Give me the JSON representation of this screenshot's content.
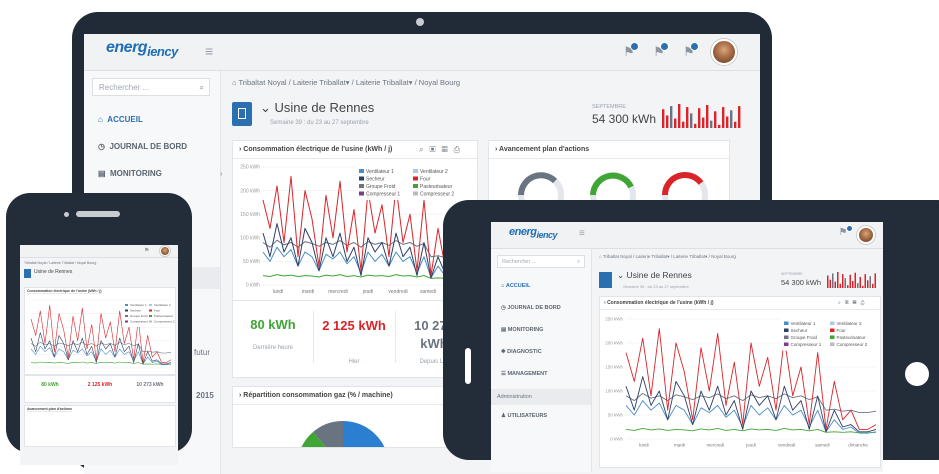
{
  "app": {
    "logo_main": "energ",
    "logo_sub": "iency"
  },
  "search": {
    "placeholder": "Rechercher ..."
  },
  "menu": [
    {
      "label": "ACCUEIL",
      "icon": "home-icon"
    },
    {
      "label": "JOURNAL DE BORD",
      "icon": "clock-icon"
    },
    {
      "label": "MONITORING",
      "icon": "chart-icon"
    },
    {
      "label": "DIAGNOSTIC",
      "icon": "gear-icon"
    },
    {
      "label": "MANAGEMENT",
      "icon": "list-icon"
    }
  ],
  "admin": {
    "section": "Administration",
    "users": "UTILISATEURS"
  },
  "breadcrumb": [
    "Tribaltat Noyal",
    "Laiterie Triballat",
    "Laiterie Triballat",
    "Noyal Bourg"
  ],
  "site": {
    "title": "Usine de Rennes",
    "subtitle": "Semaine 39 : du 23 au 27 septembre",
    "month": "SEPTEMBRE",
    "total": "54 300 kWh"
  },
  "elec_card": {
    "title": "Consommation électrique de l'usine (kWh / j)"
  },
  "plan_card": {
    "title": "Avancement plan d'actions"
  },
  "gas_card": {
    "title": "Répartition consommation gaz (% / machine)"
  },
  "kpis": [
    {
      "value": "80 kWh",
      "label": "Dernière heure"
    },
    {
      "value": "2 125 kWh",
      "label": "Hier"
    },
    {
      "value": "10 273 kWh",
      "label": "Depuis Lundi"
    }
  ],
  "phone_kpis": [
    "80 kWh",
    "2 125 kWh",
    "10 273 kWh"
  ],
  "partial": {
    "futur": "futur",
    "year": "2015"
  },
  "chart_data": {
    "type": "line",
    "title": "Consommation électrique de l'usine (kWh / j)",
    "categories": [
      "lundi",
      "mardi",
      "mercredi",
      "jeudi",
      "vendredi",
      "samedi",
      "dimanche"
    ],
    "yticks": [
      "250 kWh",
      "200 kWh",
      "150 kWh",
      "100 kWh",
      "50 kWh",
      "0 kWh"
    ],
    "ylim": [
      0,
      250
    ],
    "legend": [
      {
        "name": "Ventilateur 1",
        "color": "#4a8ec8"
      },
      {
        "name": "Ventilateur 2",
        "color": "#a9c9ea"
      },
      {
        "name": "Secheur",
        "color": "#2e3e64"
      },
      {
        "name": "Four",
        "color": "#d9252a"
      },
      {
        "name": "Groupe Froid",
        "color": "#6a7480"
      },
      {
        "name": "Pasteurisateur",
        "color": "#3fa535"
      },
      {
        "name": "Compresseur 1",
        "color": "#7a3e8c"
      },
      {
        "name": "Compresseur 2",
        "color": "#b6bcc3"
      }
    ],
    "series": [
      {
        "name": "Four",
        "color": "#d9252a",
        "values": [
          180,
          120,
          210,
          90,
          230,
          60,
          200,
          140,
          40,
          190,
          100,
          220,
          70,
          160,
          30,
          200,
          110,
          170,
          60,
          210,
          90,
          150,
          30,
          180,
          20,
          120,
          40,
          60,
          20,
          20,
          30
        ]
      },
      {
        "name": "Secheur",
        "color": "#2e3e64",
        "values": [
          110,
          60,
          130,
          70,
          100,
          40,
          120,
          90,
          30,
          100,
          60,
          110,
          50,
          80,
          20,
          100,
          70,
          90,
          40,
          110,
          60,
          80,
          20,
          90,
          15,
          60,
          25,
          30,
          15,
          15,
          20
        ]
      },
      {
        "name": "Ventilateur 1",
        "color": "#4a8ec8",
        "values": [
          70,
          50,
          80,
          60,
          75,
          40,
          70,
          60,
          30,
          65,
          55,
          70,
          45,
          60,
          25,
          70,
          50,
          65,
          40,
          70,
          50,
          60,
          25,
          60,
          15,
          40,
          20,
          25,
          12,
          12,
          15
        ]
      },
      {
        "name": "Groupe Froid",
        "color": "#6a7480",
        "values": [
          90,
          80,
          95,
          85,
          90,
          80,
          92,
          88,
          82,
          90,
          86,
          94,
          84,
          90,
          80,
          92,
          86,
          90,
          84,
          94,
          86,
          90,
          82,
          88,
          60,
          62,
          58,
          60,
          55,
          55,
          58
        ]
      },
      {
        "name": "Pasteurisateur",
        "color": "#3fa535",
        "values": [
          20,
          18,
          22,
          19,
          21,
          18,
          20,
          19,
          17,
          21,
          19,
          22,
          18,
          20,
          17,
          21,
          19,
          20,
          18,
          22,
          19,
          20,
          17,
          20,
          14,
          15,
          14,
          15,
          13,
          13,
          14
        ]
      }
    ]
  },
  "colors": {
    "brand": "#1f6fb4",
    "frame": "#212b38",
    "red": "#d9252a",
    "green": "#3fa535",
    "grey": "#6a7480"
  }
}
